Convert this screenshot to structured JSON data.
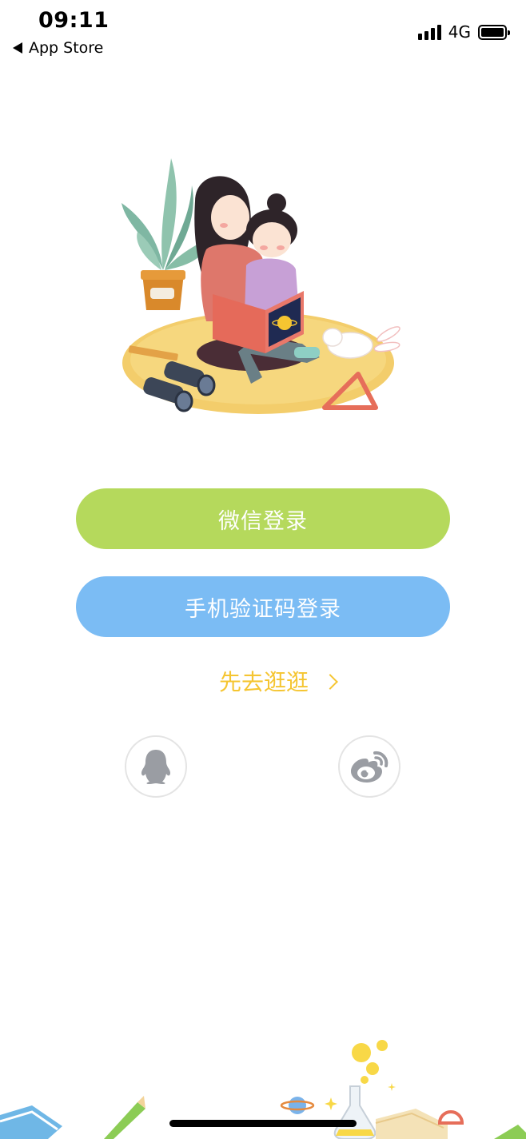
{
  "status_bar": {
    "time": "09:11",
    "back_label": "App Store",
    "network": "4G",
    "signal_bars": 4,
    "battery_level": 0.9
  },
  "login": {
    "wechat_label": "微信登录",
    "phone_label": "手机验证码登录",
    "browse_label": "先去逛逛"
  },
  "social": {
    "qq_icon": "qq-penguin-icon",
    "weibo_icon": "weibo-icon"
  },
  "colors": {
    "wechat_button": "#b5d95c",
    "phone_button": "#7bbcf4",
    "browse_text": "#f5c531"
  }
}
